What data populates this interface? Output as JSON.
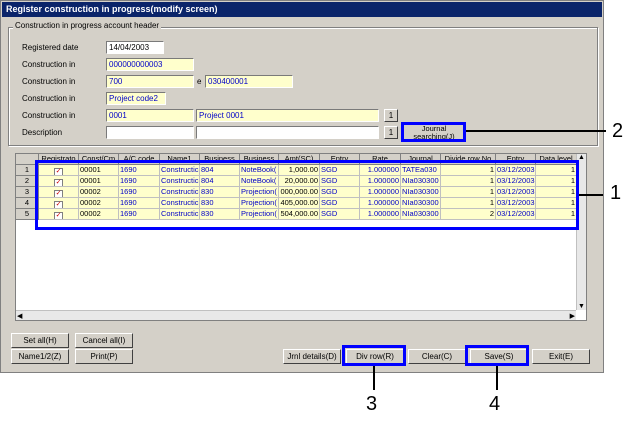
{
  "window": {
    "title": "Register construction in progress(modify screen)"
  },
  "header": {
    "group_label": "Construction in progress account header",
    "registered_date_label": "Registered date",
    "registered_date": "14/04/2003",
    "row1_label": "Construction in",
    "row1_value": "000000000003",
    "row2_label": "Construction in",
    "row2_value": "700",
    "row2_mid": "e",
    "row2_value2": "030400001",
    "row3_label": "Construction in",
    "row3_value": "Project code2",
    "row4_label": "Construction in",
    "row4_value": "0001",
    "row4_value2": "Project 0001",
    "row4_button": "1",
    "description_label": "Description",
    "description_button": "1",
    "journal_search_label": "Journal searching(J)"
  },
  "grid": {
    "columns": [
      "Registrato",
      "Const/Cm",
      "A/C code",
      "Name1",
      "Business",
      "Business",
      "Amt(SC)",
      "Entry",
      "Rate",
      "Journal",
      "Divide row No",
      "Entry",
      "Data level"
    ],
    "rows": [
      {
        "num": "1",
        "c1": "00001",
        "c2": "1690",
        "c3": "Constructic",
        "c4": "804",
        "c5": "NoteBook(",
        "c6": "1,000.00",
        "c7": "SGD",
        "c8": "1.000000",
        "c9": "TATEa030",
        "c10": "1",
        "c11": "03/12/2003",
        "c12": "1"
      },
      {
        "num": "2",
        "c1": "00001",
        "c2": "1690",
        "c3": "Constructic",
        "c4": "804",
        "c5": "NoteBook(",
        "c6": "20,000.00",
        "c7": "SGD",
        "c8": "1.000000",
        "c9": "NIa030300",
        "c10": "1",
        "c11": "03/12/2003",
        "c12": "1"
      },
      {
        "num": "3",
        "c1": "00002",
        "c2": "1690",
        "c3": "Constructic",
        "c4": "830",
        "c5": "Projection(",
        "c6": "000,000.00",
        "c7": "SGD",
        "c8": "1.000000",
        "c9": "NIa030300",
        "c10": "1",
        "c11": "03/12/2003",
        "c12": "1"
      },
      {
        "num": "4",
        "c1": "00002",
        "c2": "1690",
        "c3": "Constructic",
        "c4": "830",
        "c5": "Projection(",
        "c6": "405,000.00",
        "c7": "SGD",
        "c8": "1.000000",
        "c9": "NIa030300",
        "c10": "1",
        "c11": "03/12/2003",
        "c12": "1"
      },
      {
        "num": "5",
        "c1": "00002",
        "c2": "1690",
        "c3": "Constructic",
        "c4": "830",
        "c5": "Projection(",
        "c6": "504,000.00",
        "c7": "SGD",
        "c8": "1.000000",
        "c9": "NIa030300",
        "c10": "2",
        "c11": "03/12/2003",
        "c12": "1"
      }
    ]
  },
  "buttons": {
    "set_all": "Set all(H)",
    "cancel_all": "Cancel all(I)",
    "name12": "Name1/2(Z)",
    "print": "Print(P)",
    "jnl_details": "Jrnl details(D)",
    "div_row": "Div row(R)",
    "clear": "Clear(C)",
    "save": "Save(S)",
    "exit": "Exit(E)"
  },
  "callouts": [
    "1",
    "2",
    "3",
    "4"
  ],
  "icons": {
    "check": "checkmark-icon",
    "scroll_up": "scroll-up-arrow-icon",
    "scroll_down": "scroll-down-arrow-icon",
    "scroll_right": "scroll-right-arrow-icon"
  },
  "colors": {
    "title_bar": "#0a246a",
    "field_yellow": "#ffffcc",
    "callout": "#0000ff"
  }
}
